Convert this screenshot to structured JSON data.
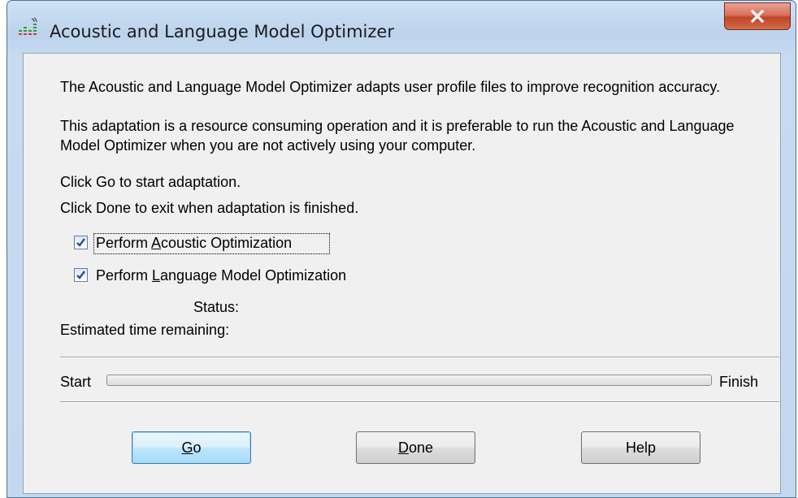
{
  "window": {
    "title": "Acoustic and Language Model Optimizer"
  },
  "description": {
    "line1": "The Acoustic and Language Model Optimizer adapts user profile files to improve recognition accuracy.",
    "line2": "This adaptation is a resource consuming operation and it is preferable to run the Acoustic and Language Model Optimizer when you are not actively using your computer."
  },
  "instructions": {
    "go": "Click Go to start adaptation.",
    "done": "Click Done to exit when adaptation is finished."
  },
  "options": {
    "acoustic": {
      "label_pre": "Perform ",
      "mnemonic": "A",
      "label_post": "coustic Optimization",
      "checked": true
    },
    "language": {
      "label_pre": "Perform ",
      "mnemonic": "L",
      "label_post": "anguage Model Optimization",
      "checked": true
    }
  },
  "status": {
    "status_label": "Status:",
    "time_label": "Estimated time remaining:"
  },
  "progress": {
    "start_label": "Start",
    "finish_label": "Finish",
    "value": 0
  },
  "buttons": {
    "go": {
      "mnemonic": "G",
      "rest": "o"
    },
    "done": {
      "mnemonic": "D",
      "rest": "one"
    },
    "help": "Help"
  },
  "colors": {
    "close_button": "#c14528",
    "frame": "#c3d8ee",
    "default_button": "#bee6fd"
  },
  "icons": {
    "app": "speech-levels-icon",
    "close": "close-x-icon",
    "check": "checkmark-icon"
  }
}
